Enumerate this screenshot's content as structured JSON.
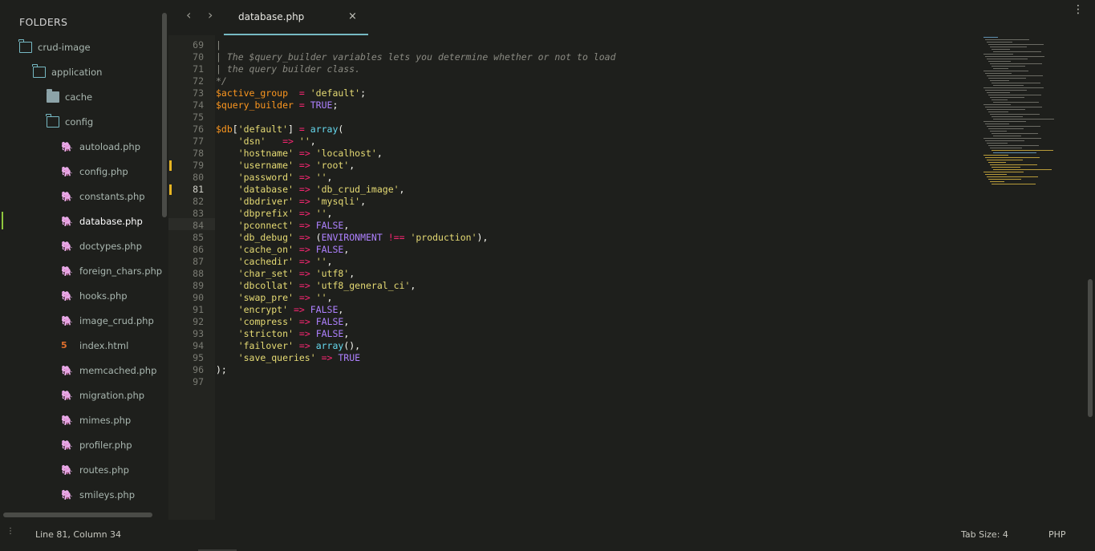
{
  "sidebar": {
    "header": "FOLDERS",
    "items": [
      {
        "label": "crud-image",
        "type": "folder-open",
        "indent": 0
      },
      {
        "label": "application",
        "type": "folder-open",
        "indent": 1
      },
      {
        "label": "cache",
        "type": "folder-closed",
        "indent": 2
      },
      {
        "label": "config",
        "type": "folder-open",
        "indent": 2
      },
      {
        "label": "autoload.php",
        "type": "php",
        "indent": 3
      },
      {
        "label": "config.php",
        "type": "php",
        "indent": 3
      },
      {
        "label": "constants.php",
        "type": "php",
        "indent": 3
      },
      {
        "label": "database.php",
        "type": "php",
        "indent": 3,
        "active": true
      },
      {
        "label": "doctypes.php",
        "type": "php",
        "indent": 3
      },
      {
        "label": "foreign_chars.php",
        "type": "php",
        "indent": 3
      },
      {
        "label": "hooks.php",
        "type": "php",
        "indent": 3
      },
      {
        "label": "image_crud.php",
        "type": "php",
        "indent": 3
      },
      {
        "label": "index.html",
        "type": "html",
        "indent": 3
      },
      {
        "label": "memcached.php",
        "type": "php",
        "indent": 3
      },
      {
        "label": "migration.php",
        "type": "php",
        "indent": 3
      },
      {
        "label": "mimes.php",
        "type": "php",
        "indent": 3
      },
      {
        "label": "profiler.php",
        "type": "php",
        "indent": 3
      },
      {
        "label": "routes.php",
        "type": "php",
        "indent": 3
      },
      {
        "label": "smileys.php",
        "type": "php",
        "indent": 3
      }
    ]
  },
  "tabbar": {
    "back_icon": "‹",
    "forward_icon": "›",
    "active_tab": "database.php",
    "close_glyph": "×",
    "menu_glyph": "⋮"
  },
  "editor": {
    "current_line": 81,
    "modified_lines": [
      79,
      81
    ],
    "lines": [
      {
        "n": 69,
        "t": [
          [
            "c-com",
            "|"
          ]
        ]
      },
      {
        "n": 70,
        "t": [
          [
            "c-com",
            "| The $query_builder variables lets you determine whether or not to load"
          ]
        ]
      },
      {
        "n": 71,
        "t": [
          [
            "c-com",
            "| the query builder class."
          ]
        ]
      },
      {
        "n": 72,
        "t": [
          [
            "c-com",
            "*/"
          ]
        ]
      },
      {
        "n": 73,
        "t": [
          [
            "c-var",
            "$active_group"
          ],
          [
            "",
            "  "
          ],
          [
            "c-op",
            "="
          ],
          [
            "",
            " "
          ],
          [
            "c-str",
            "'default'"
          ],
          [
            "",
            ";"
          ]
        ]
      },
      {
        "n": 74,
        "t": [
          [
            "c-var",
            "$query_builder"
          ],
          [
            "",
            " "
          ],
          [
            "c-op",
            "="
          ],
          [
            "",
            " "
          ],
          [
            "c-const",
            "TRUE"
          ],
          [
            "",
            ";"
          ]
        ]
      },
      {
        "n": 75,
        "t": []
      },
      {
        "n": 76,
        "t": [
          [
            "c-var",
            "$db"
          ],
          [
            "",
            "["
          ],
          [
            "c-str",
            "'default'"
          ],
          [
            "",
            "] "
          ],
          [
            "c-op",
            "="
          ],
          [
            "",
            " "
          ],
          [
            "c-fn",
            "array"
          ],
          [
            "",
            "("
          ]
        ]
      },
      {
        "n": 77,
        "t": [
          [
            "",
            "    "
          ],
          [
            "c-str",
            "'dsn'"
          ],
          [
            "",
            "   "
          ],
          [
            "c-op",
            "=>"
          ],
          [
            "",
            " "
          ],
          [
            "c-str",
            "''"
          ],
          [
            "",
            ","
          ]
        ]
      },
      {
        "n": 78,
        "t": [
          [
            "",
            "    "
          ],
          [
            "c-str",
            "'hostname'"
          ],
          [
            "",
            " "
          ],
          [
            "c-op",
            "=>"
          ],
          [
            "",
            " "
          ],
          [
            "c-str",
            "'localhost'"
          ],
          [
            "",
            ","
          ]
        ]
      },
      {
        "n": 79,
        "t": [
          [
            "",
            "    "
          ],
          [
            "c-str",
            "'username'"
          ],
          [
            "",
            " "
          ],
          [
            "c-op",
            "=>"
          ],
          [
            "",
            " "
          ],
          [
            "c-str",
            "'root'"
          ],
          [
            "",
            ","
          ]
        ]
      },
      {
        "n": 80,
        "t": [
          [
            "",
            "    "
          ],
          [
            "c-str",
            "'password'"
          ],
          [
            "",
            " "
          ],
          [
            "c-op",
            "=>"
          ],
          [
            "",
            " "
          ],
          [
            "c-str",
            "''"
          ],
          [
            "",
            ","
          ]
        ]
      },
      {
        "n": 81,
        "t": [
          [
            "",
            "    "
          ],
          [
            "c-str",
            "'database'"
          ],
          [
            "",
            " "
          ],
          [
            "c-op",
            "=>"
          ],
          [
            "",
            " "
          ],
          [
            "c-str",
            "'db_crud_image'"
          ],
          [
            "",
            ","
          ]
        ]
      },
      {
        "n": 82,
        "t": [
          [
            "",
            "    "
          ],
          [
            "c-str",
            "'dbdriver'"
          ],
          [
            "",
            " "
          ],
          [
            "c-op",
            "=>"
          ],
          [
            "",
            " "
          ],
          [
            "c-str",
            "'mysqli'"
          ],
          [
            "",
            ","
          ]
        ]
      },
      {
        "n": 83,
        "t": [
          [
            "",
            "    "
          ],
          [
            "c-str",
            "'dbprefix'"
          ],
          [
            "",
            " "
          ],
          [
            "c-op",
            "=>"
          ],
          [
            "",
            " "
          ],
          [
            "c-str",
            "''"
          ],
          [
            "",
            ","
          ]
        ]
      },
      {
        "n": 84,
        "t": [
          [
            "",
            "    "
          ],
          [
            "c-str",
            "'pconnect'"
          ],
          [
            "",
            " "
          ],
          [
            "c-op",
            "=>"
          ],
          [
            "",
            " "
          ],
          [
            "c-const",
            "FALSE"
          ],
          [
            "",
            ","
          ]
        ]
      },
      {
        "n": 85,
        "t": [
          [
            "",
            "    "
          ],
          [
            "c-str",
            "'db_debug'"
          ],
          [
            "",
            " "
          ],
          [
            "c-op",
            "=>"
          ],
          [
            "",
            " ("
          ],
          [
            "c-const",
            "ENVIRONMENT"
          ],
          [
            "",
            " "
          ],
          [
            "c-op",
            "!=="
          ],
          [
            "",
            " "
          ],
          [
            "c-str",
            "'production'"
          ],
          [
            "",
            "),"
          ]
        ]
      },
      {
        "n": 86,
        "t": [
          [
            "",
            "    "
          ],
          [
            "c-str",
            "'cache_on'"
          ],
          [
            "",
            " "
          ],
          [
            "c-op",
            "=>"
          ],
          [
            "",
            " "
          ],
          [
            "c-const",
            "FALSE"
          ],
          [
            "",
            ","
          ]
        ]
      },
      {
        "n": 87,
        "t": [
          [
            "",
            "    "
          ],
          [
            "c-str",
            "'cachedir'"
          ],
          [
            "",
            " "
          ],
          [
            "c-op",
            "=>"
          ],
          [
            "",
            " "
          ],
          [
            "c-str",
            "''"
          ],
          [
            "",
            ","
          ]
        ]
      },
      {
        "n": 88,
        "t": [
          [
            "",
            "    "
          ],
          [
            "c-str",
            "'char_set'"
          ],
          [
            "",
            " "
          ],
          [
            "c-op",
            "=>"
          ],
          [
            "",
            " "
          ],
          [
            "c-str",
            "'utf8'"
          ],
          [
            "",
            ","
          ]
        ]
      },
      {
        "n": 89,
        "t": [
          [
            "",
            "    "
          ],
          [
            "c-str",
            "'dbcollat'"
          ],
          [
            "",
            " "
          ],
          [
            "c-op",
            "=>"
          ],
          [
            "",
            " "
          ],
          [
            "c-str",
            "'utf8_general_ci'"
          ],
          [
            "",
            ","
          ]
        ]
      },
      {
        "n": 90,
        "t": [
          [
            "",
            "    "
          ],
          [
            "c-str",
            "'swap_pre'"
          ],
          [
            "",
            " "
          ],
          [
            "c-op",
            "=>"
          ],
          [
            "",
            " "
          ],
          [
            "c-str",
            "''"
          ],
          [
            "",
            ","
          ]
        ]
      },
      {
        "n": 91,
        "t": [
          [
            "",
            "    "
          ],
          [
            "c-str",
            "'encrypt'"
          ],
          [
            "",
            " "
          ],
          [
            "c-op",
            "=>"
          ],
          [
            "",
            " "
          ],
          [
            "c-const",
            "FALSE"
          ],
          [
            "",
            ","
          ]
        ]
      },
      {
        "n": 92,
        "t": [
          [
            "",
            "    "
          ],
          [
            "c-str",
            "'compress'"
          ],
          [
            "",
            " "
          ],
          [
            "c-op",
            "=>"
          ],
          [
            "",
            " "
          ],
          [
            "c-const",
            "FALSE"
          ],
          [
            "",
            ","
          ]
        ]
      },
      {
        "n": 93,
        "t": [
          [
            "",
            "    "
          ],
          [
            "c-str",
            "'stricton'"
          ],
          [
            "",
            " "
          ],
          [
            "c-op",
            "=>"
          ],
          [
            "",
            " "
          ],
          [
            "c-const",
            "FALSE"
          ],
          [
            "",
            ","
          ]
        ]
      },
      {
        "n": 94,
        "t": [
          [
            "",
            "    "
          ],
          [
            "c-str",
            "'failover'"
          ],
          [
            "",
            " "
          ],
          [
            "c-op",
            "=>"
          ],
          [
            "",
            " "
          ],
          [
            "c-fn",
            "array"
          ],
          [
            "",
            "(),"
          ]
        ]
      },
      {
        "n": 95,
        "t": [
          [
            "",
            "    "
          ],
          [
            "c-str",
            "'save_queries'"
          ],
          [
            "",
            " "
          ],
          [
            "c-op",
            "=>"
          ],
          [
            "",
            " "
          ],
          [
            "c-const",
            "TRUE"
          ]
        ]
      },
      {
        "n": 96,
        "t": [
          [
            "",
            ");"
          ]
        ]
      },
      {
        "n": 97,
        "t": []
      }
    ]
  },
  "status": {
    "position": "Line 81, Column 34",
    "tab_size": "Tab Size: 4",
    "syntax": "PHP"
  }
}
